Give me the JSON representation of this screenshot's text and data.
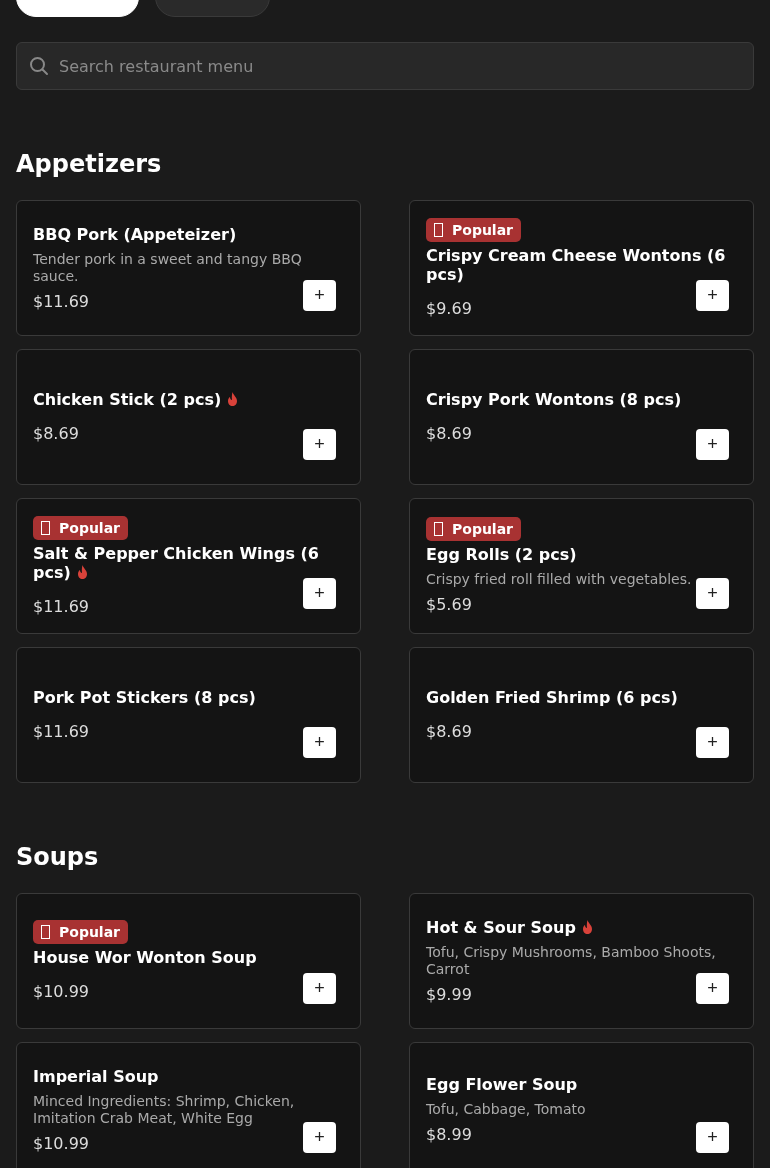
{
  "category_tabs": [
    {
      "selected": true
    },
    {
      "selected": false
    }
  ],
  "search": {
    "placeholder": "Search restaurant menu"
  },
  "sections": [
    {
      "title": "Appetizers",
      "items": [
        {
          "name": "BBQ Pork (Appeteizer)",
          "description": "Tender pork in a sweet and tangy BBQ sauce.",
          "price": "$11.69",
          "popular": false,
          "spicy": false,
          "add_button": "+"
        },
        {
          "name": "Crispy Cream Cheese Wontons (6 pcs)",
          "price": "$9.69",
          "popular": true,
          "popular_label": "Popular",
          "spicy": false,
          "add_button": "+"
        },
        {
          "name": "Chicken Stick (2 pcs)",
          "price": "$8.69",
          "popular": false,
          "spicy": true,
          "add_button": "+"
        },
        {
          "name": "Crispy Pork Wontons (8 pcs)",
          "price": "$8.69",
          "popular": false,
          "spicy": false,
          "add_button": "+"
        },
        {
          "name": "Salt & Pepper Chicken Wings (6 pcs)",
          "price": "$11.69",
          "popular": true,
          "popular_label": "Popular",
          "spicy": true,
          "add_button": "+"
        },
        {
          "name": "Egg Rolls (2 pcs)",
          "description": "Crispy fried roll filled with vegetables.",
          "price": "$5.69",
          "popular": true,
          "popular_label": "Popular",
          "spicy": false,
          "add_button": "+"
        },
        {
          "name": "Pork Pot Stickers (8 pcs)",
          "price": "$11.69",
          "popular": false,
          "spicy": false,
          "add_button": "+"
        },
        {
          "name": "Golden Fried Shrimp (6 pcs)",
          "price": "$8.69",
          "popular": false,
          "spicy": false,
          "add_button": "+"
        }
      ]
    },
    {
      "title": "Soups",
      "items": [
        {
          "name": "House Wor Wonton Soup",
          "price": "$10.99",
          "popular": true,
          "popular_label": "Popular",
          "spicy": false,
          "add_button": "+"
        },
        {
          "name": "Hot & Sour Soup",
          "description": "Tofu, Crispy Mushrooms, Bamboo Shoots, Carrot",
          "price": "$9.99",
          "popular": false,
          "spicy": true,
          "add_button": "+"
        },
        {
          "name": "Imperial Soup",
          "description": "Minced Ingredients: Shrimp, Chicken, Imitation Crab Meat, White Egg",
          "price": "$10.99",
          "popular": false,
          "spicy": false,
          "add_button": "+"
        },
        {
          "name": "Egg Flower Soup",
          "description": "Tofu, Cabbage, Tomato",
          "price": "$8.99",
          "popular": false,
          "spicy": false,
          "add_button": "+"
        }
      ]
    }
  ]
}
